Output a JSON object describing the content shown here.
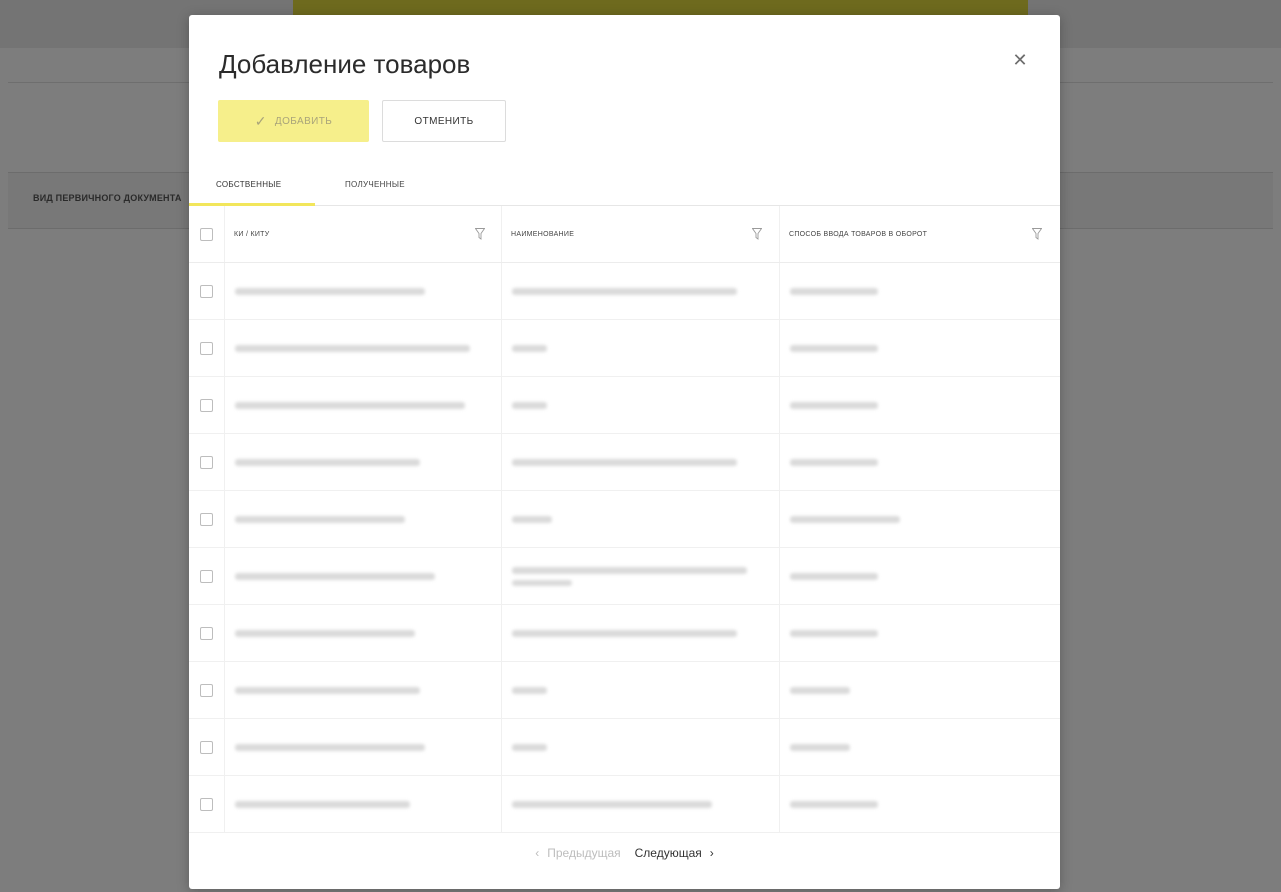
{
  "background": {
    "column_header": "Вид первичного документа"
  },
  "modal": {
    "title": "Добавление товаров",
    "buttons": {
      "add_label": "Добавить",
      "cancel_label": "Отменить"
    },
    "tabs": [
      {
        "label": "Собственные",
        "active": true
      },
      {
        "label": "Полученные",
        "active": false
      }
    ],
    "table": {
      "columns": [
        "КИ / КИТУ",
        "Наименование",
        "Способ ввода товаров в оборот"
      ],
      "rows": [
        {
          "col1": "",
          "col2": "",
          "col3": ""
        },
        {
          "col1": "",
          "col2": "",
          "col3": ""
        },
        {
          "col1": "",
          "col2": "",
          "col3": ""
        },
        {
          "col1": "",
          "col2": "",
          "col3": ""
        },
        {
          "col1": "",
          "col2": "",
          "col3": ""
        },
        {
          "col1": "",
          "col2": "",
          "col3": ""
        },
        {
          "col1": "",
          "col2": "",
          "col3": ""
        },
        {
          "col1": "",
          "col2": "",
          "col3": ""
        },
        {
          "col1": "",
          "col2": "",
          "col3": ""
        },
        {
          "col1": "",
          "col2": "",
          "col3": ""
        }
      ]
    },
    "pagination": {
      "prev_label": "Предыдущая",
      "next_label": "Следующая"
    }
  },
  "colors": {
    "accent_yellow": "#f6ef8b",
    "tab_underline": "#f2e65b",
    "overlay": "#7d7d7d"
  },
  "icons": {
    "close": "close-icon",
    "check": "check-icon",
    "filter": "filter-icon",
    "prev": "chevron-left-icon",
    "next": "chevron-right-icon"
  }
}
